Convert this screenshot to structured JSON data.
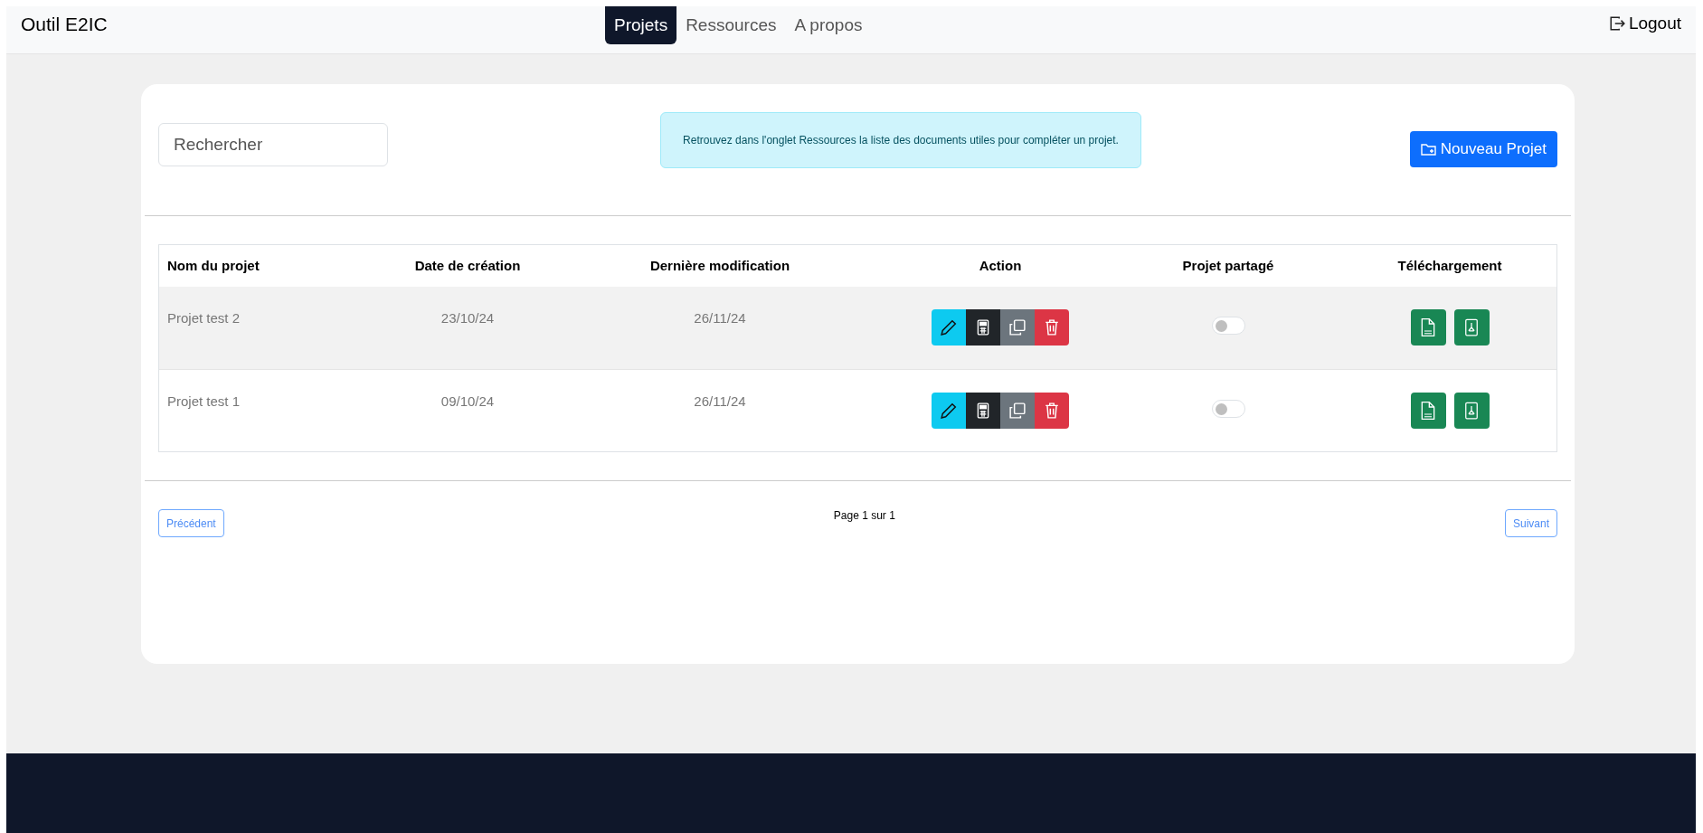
{
  "brand": "Outil E2IC",
  "nav": [
    {
      "label": "Projets",
      "selected": true
    },
    {
      "label": "Ressources",
      "selected": false
    },
    {
      "label": "A propos",
      "selected": false
    }
  ],
  "logout": "Logout",
  "search": {
    "placeholder": "Rechercher"
  },
  "info": "Retrouvez dans l'onglet Ressources la liste des documents utiles pour compléter un projet.",
  "new_project": "Nouveau Projet",
  "table": {
    "columns": [
      "Nom du projet",
      "Date de création",
      "Dernière modification",
      "Action",
      "Projet partagé",
      "Téléchargement"
    ],
    "rows": [
      {
        "name": "Projet test 2",
        "created": "23/10/24",
        "modified": "26/11/24",
        "shared": false
      },
      {
        "name": "Projet test 1",
        "created": "09/10/24",
        "modified": "26/11/24",
        "shared": false
      }
    ]
  },
  "pagination": {
    "previous": "Précédent",
    "page": "Page 1 sur 1",
    "next": "Suivant"
  }
}
